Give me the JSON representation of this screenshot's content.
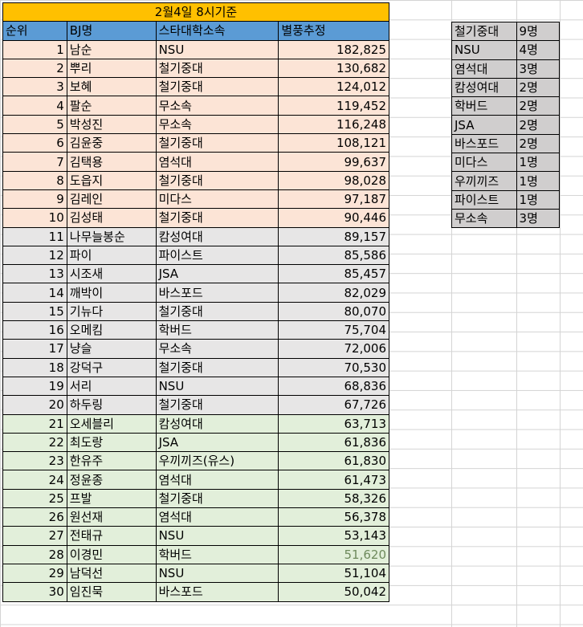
{
  "sheet": {
    "title": "2월4일 8시기준",
    "headers": [
      "순위",
      "BJ명",
      "스타대학소속",
      "별풍추정"
    ],
    "rows": [
      {
        "rank": "1",
        "name": "남순",
        "school": "NSU",
        "value": "182,825"
      },
      {
        "rank": "2",
        "name": "뿌리",
        "school": "철기중대",
        "value": "130,682"
      },
      {
        "rank": "3",
        "name": "보혜",
        "school": "철기중대",
        "value": "124,012"
      },
      {
        "rank": "4",
        "name": "팔순",
        "school": "무소속",
        "value": "119,452"
      },
      {
        "rank": "5",
        "name": "박성진",
        "school": "무소속",
        "value": "116,248"
      },
      {
        "rank": "6",
        "name": "김윤중",
        "school": "철기중대",
        "value": "108,121"
      },
      {
        "rank": "7",
        "name": "김택용",
        "school": "염석대",
        "value": "99,637"
      },
      {
        "rank": "8",
        "name": "도읍지",
        "school": "철기중대",
        "value": "98,028"
      },
      {
        "rank": "9",
        "name": "김레인",
        "school": "미다스",
        "value": "97,187"
      },
      {
        "rank": "10",
        "name": "김성태",
        "school": "철기중대",
        "value": "90,446"
      },
      {
        "rank": "11",
        "name": "나무늘봉순",
        "school": "캄성여대",
        "value": "89,157"
      },
      {
        "rank": "12",
        "name": "파이",
        "school": "파이스트",
        "value": "85,586"
      },
      {
        "rank": "13",
        "name": "시조새",
        "school": "JSA",
        "value": "85,457"
      },
      {
        "rank": "14",
        "name": "깨박이",
        "school": "바스포드",
        "value": "82,029"
      },
      {
        "rank": "15",
        "name": "기뉴다",
        "school": "철기중대",
        "value": "80,070"
      },
      {
        "rank": "16",
        "name": "오메킴",
        "school": "학버드",
        "value": "75,704"
      },
      {
        "rank": "17",
        "name": "냥슬",
        "school": "무소속",
        "value": "72,006"
      },
      {
        "rank": "18",
        "name": "강덕구",
        "school": "철기중대",
        "value": "70,530"
      },
      {
        "rank": "19",
        "name": "서리",
        "school": "NSU",
        "value": "68,836"
      },
      {
        "rank": "20",
        "name": "하두링",
        "school": "철기중대",
        "value": "67,726"
      },
      {
        "rank": "21",
        "name": "오세블리",
        "school": "캄성여대",
        "value": "63,713"
      },
      {
        "rank": "22",
        "name": "최도랑",
        "school": "JSA",
        "value": "61,836"
      },
      {
        "rank": "23",
        "name": "한유주",
        "school": "우끼끼즈(유스)",
        "value": "61,830"
      },
      {
        "rank": "24",
        "name": "정윤종",
        "school": "염석대",
        "value": "61,473"
      },
      {
        "rank": "25",
        "name": "프발",
        "school": "철기중대",
        "value": "58,326"
      },
      {
        "rank": "26",
        "name": "원선재",
        "school": "염석대",
        "value": "56,378"
      },
      {
        "rank": "27",
        "name": "전태규",
        "school": "NSU",
        "value": "53,143"
      },
      {
        "rank": "28",
        "name": "이경민",
        "school": "학버드",
        "value": "51,620"
      },
      {
        "rank": "29",
        "name": "남덕선",
        "school": "NSU",
        "value": "51,104"
      },
      {
        "rank": "30",
        "name": "임진묵",
        "school": "바스포드",
        "value": "50,042"
      }
    ]
  },
  "summary": [
    {
      "school": "철기중대",
      "count": "9명"
    },
    {
      "school": "NSU",
      "count": "4명"
    },
    {
      "school": "염석대",
      "count": "3명"
    },
    {
      "school": "캄성여대",
      "count": "2명"
    },
    {
      "school": "학버드",
      "count": "2명"
    },
    {
      "school": "JSA",
      "count": "2명"
    },
    {
      "school": "바스포드",
      "count": "2명"
    },
    {
      "school": "미다스",
      "count": "1명"
    },
    {
      "school": "우끼끼즈",
      "count": "1명"
    },
    {
      "school": "파이스트",
      "count": "1명"
    },
    {
      "school": "무소속",
      "count": "3명"
    }
  ],
  "colors": {
    "title_bg": "#ffc000",
    "header_bg": "#5b9bd5",
    "tier1_bg": "#fce4d6",
    "tier2_bg": "#e7e6e6",
    "tier3_bg": "#e2efda",
    "summary_bg": "#d0cece"
  }
}
